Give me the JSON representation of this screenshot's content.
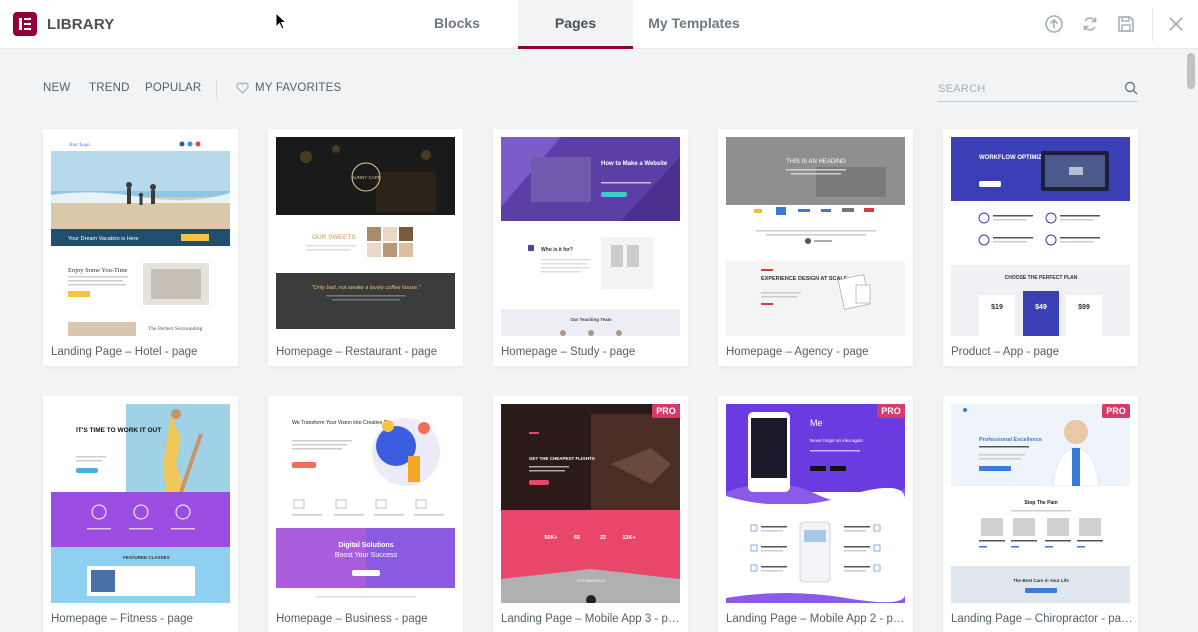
{
  "header": {
    "title": "LIBRARY",
    "tabs": [
      {
        "label": "Blocks",
        "active": false
      },
      {
        "label": "Pages",
        "active": true
      },
      {
        "label": "My Templates",
        "active": false
      }
    ],
    "icons": [
      "upload-icon",
      "sync-icon",
      "save-icon",
      "close-icon"
    ],
    "accent_color": "#92003b"
  },
  "filters": {
    "items": [
      "NEW",
      "TREND",
      "POPULAR"
    ],
    "favorites_label": "MY FAVORITES"
  },
  "search": {
    "placeholder": "SEARCH",
    "value": ""
  },
  "cards": [
    {
      "title": "Landing Page – Hotel - page",
      "pro": false
    },
    {
      "title": "Homepage – Restaurant - page",
      "pro": false
    },
    {
      "title": "Homepage – Study - page",
      "pro": false
    },
    {
      "title": "Homepage – Agency - page",
      "pro": false
    },
    {
      "title": "Product – App - page",
      "pro": false
    },
    {
      "title": "Homepage – Fitness - page",
      "pro": false
    },
    {
      "title": "Homepage – Business - page",
      "pro": false
    },
    {
      "title": "Landing Page – Mobile App 3 - pa...",
      "pro": true
    },
    {
      "title": "Landing Page – Mobile App 2 - pa...",
      "pro": true
    },
    {
      "title": "Landing Page – Chiropractor - page",
      "pro": true
    }
  ],
  "pro_label": "PRO",
  "thumb_text": {
    "hotel_logo": "Your Logo",
    "hotel_banner": "Your Dream Vacation is Here",
    "hotel_heading": "Enjoy Some You-Time",
    "hotel_sub": "The Perfect Surrounding",
    "rest_logo": "SUNNY CAFE",
    "rest_heading": "OUR SWEETS",
    "rest_quote": "\"Only bad, not awake a lovely coffee house.\"",
    "study_heading": "How to Make a Website",
    "study_who": "Who is it for?",
    "study_team": "Our Teaching Team",
    "agency_heading": "THIS IS AN HEADING",
    "agency_scale": "EXPERIENCE DESIGN AT SCALE",
    "product_heading": "WORKFLOW OPTIMIZATION MADE EASY",
    "product_plan": "CHOOSE THE PERFECT PLAN",
    "product_prices": [
      "$19",
      "$49",
      "$99"
    ],
    "fitness_heading": "IT'S TIME TO WORK IT OUT",
    "fitness_classes": "FEATURED CLASSES",
    "business_heading": "We Transform Your Vision into Creative Results",
    "business_digital": "Digital Solutions",
    "business_boost": "Boost Your Success",
    "app3_heading": "GET THE CHEAPEST FLIGHTS",
    "app3_stats": [
      "50K+",
      "65",
      "22",
      "13K+"
    ],
    "app3_testimonials": "TESTIMONIALS",
    "app2_logo": "Me",
    "app2_heading": "Never forget an idea again",
    "chiro_heading": "Professional Excellence",
    "chiro_stop": "Stop The Pain",
    "chiro_best": "The Best Care in Your Life"
  }
}
